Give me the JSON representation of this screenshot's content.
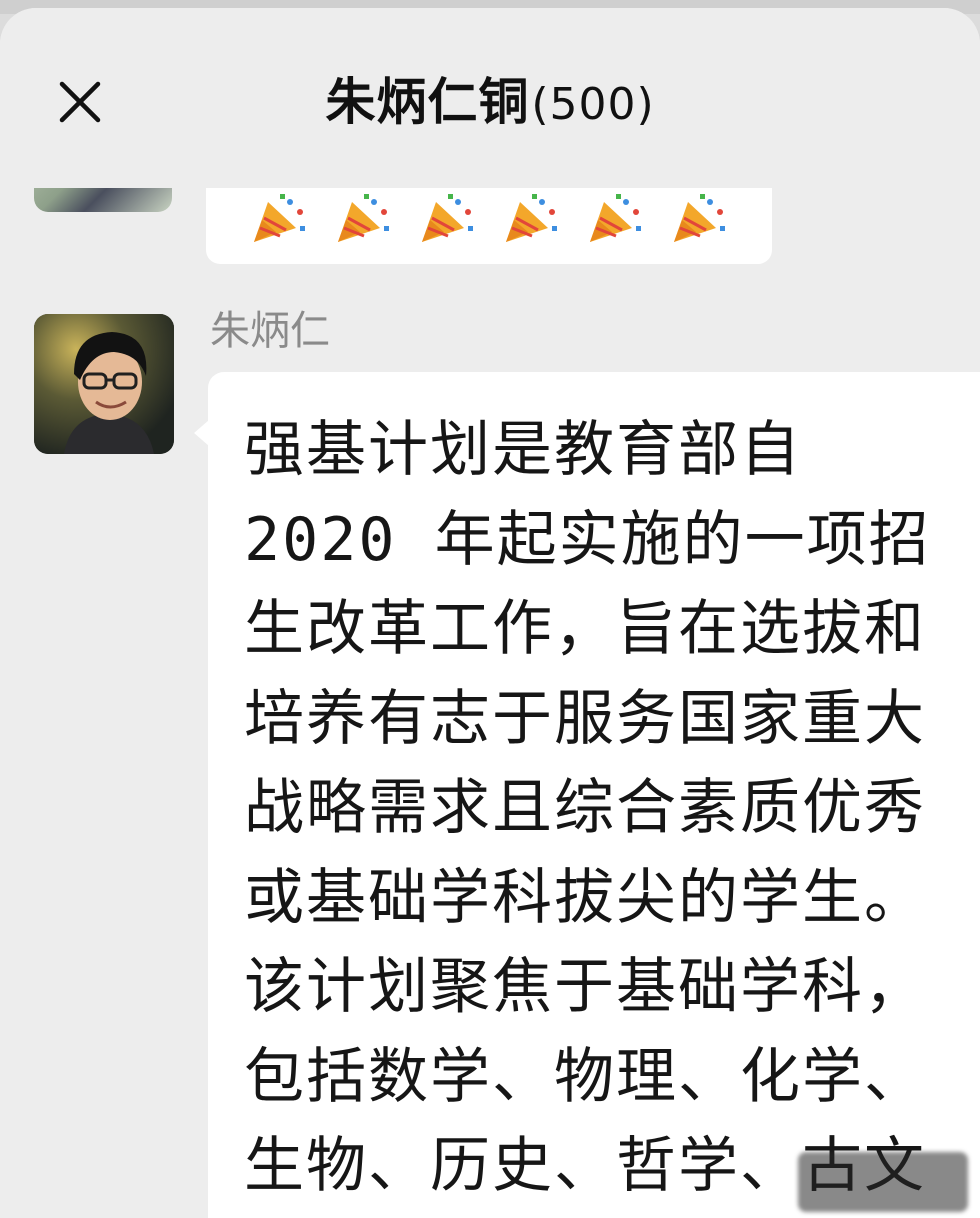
{
  "header": {
    "title": "朱炳仁铜",
    "member_count": "(500)"
  },
  "previous_message": {
    "emoji_icons": [
      "party-popper",
      "party-popper",
      "party-popper",
      "party-popper",
      "party-popper",
      "party-popper"
    ]
  },
  "message": {
    "sender": "朱炳仁",
    "text_lines": [
      "强基计划是教育部自",
      "2020 年起实施的一项招",
      "生改革工作，旨在选拔和",
      "培养有志于服务国家重大",
      "战略需求且综合素质优秀",
      "或基础学科拔尖的学生。",
      "该计划聚焦于基础学科，",
      "包括数学、物理、化学、",
      "生物、历史、哲学、古文"
    ]
  },
  "colors": {
    "background": "#ededed",
    "bubble": "#ffffff",
    "sender_name": "#8a8a8a",
    "title": "#111111"
  }
}
